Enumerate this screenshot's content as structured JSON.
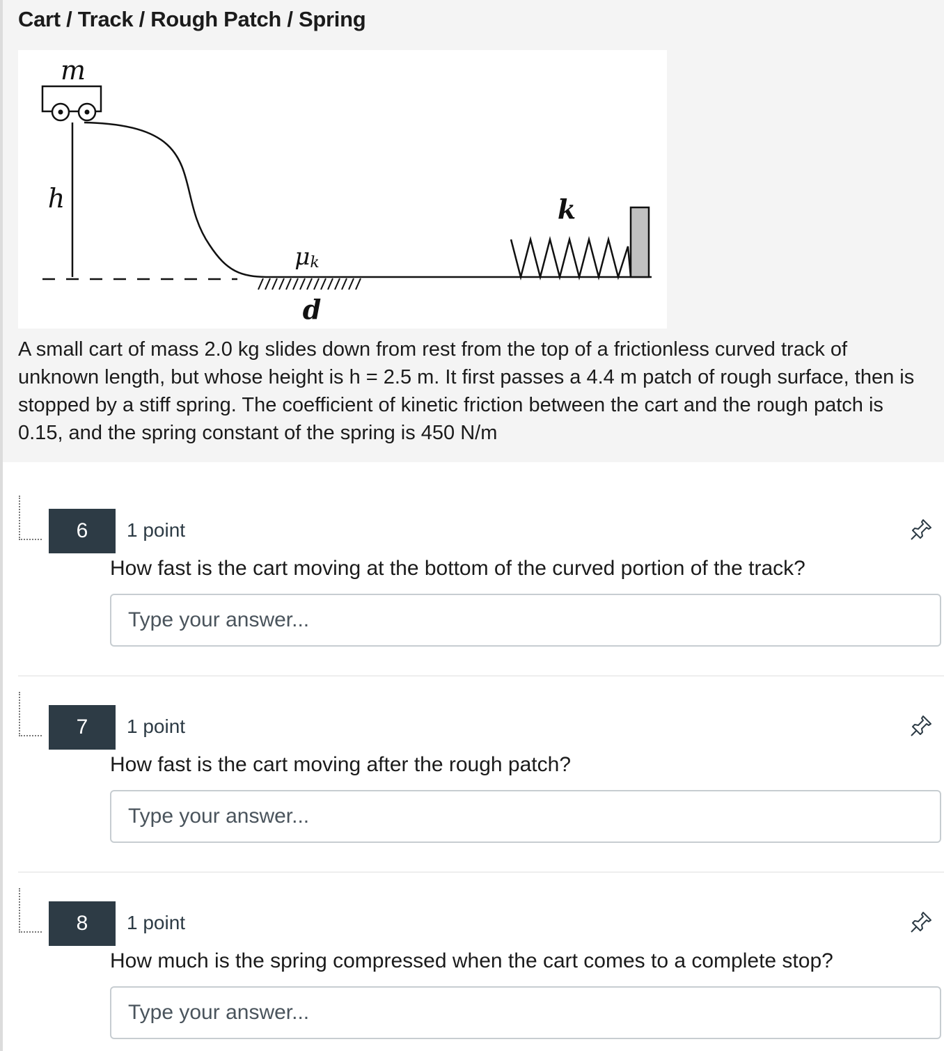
{
  "intro": {
    "title": "Cart / Track / Rough Patch / Spring",
    "figure_labels": {
      "mass": "m",
      "height": "h",
      "friction": "μ",
      "friction_sub": "k",
      "spring": "k",
      "distance": "d"
    },
    "text": "A small cart of mass 2.0 kg slides down from rest from the top of a frictionless curved track of unknown length, but whose height is h = 2.5 m. It first passes a 4.4 m patch of rough surface, then is stopped by a stiff spring. The coefficient of kinetic friction between the cart and the rough patch is 0.15, and the spring constant of the spring is 450 N/m"
  },
  "questions": [
    {
      "number": "6",
      "points": "1 point",
      "text": "How fast is the cart moving at the bottom of the curved portion of the track?",
      "answer_value": "",
      "answer_placeholder": "Type your answer..."
    },
    {
      "number": "7",
      "points": "1 point",
      "text": "How fast is the cart moving after the rough patch?",
      "answer_value": "",
      "answer_placeholder": "Type your answer..."
    },
    {
      "number": "8",
      "points": "1 point",
      "text": "How much is the spring compressed when the cart comes to a complete stop?",
      "answer_value": "",
      "answer_placeholder": "Type your answer..."
    }
  ],
  "icons": {
    "drag": "drag-handle-icon",
    "pin": "pin-icon"
  },
  "colors": {
    "number_badge_bg": "#2d3b45",
    "intro_bg": "#f4f4f4",
    "wall_fill": "#c0c0c0"
  }
}
